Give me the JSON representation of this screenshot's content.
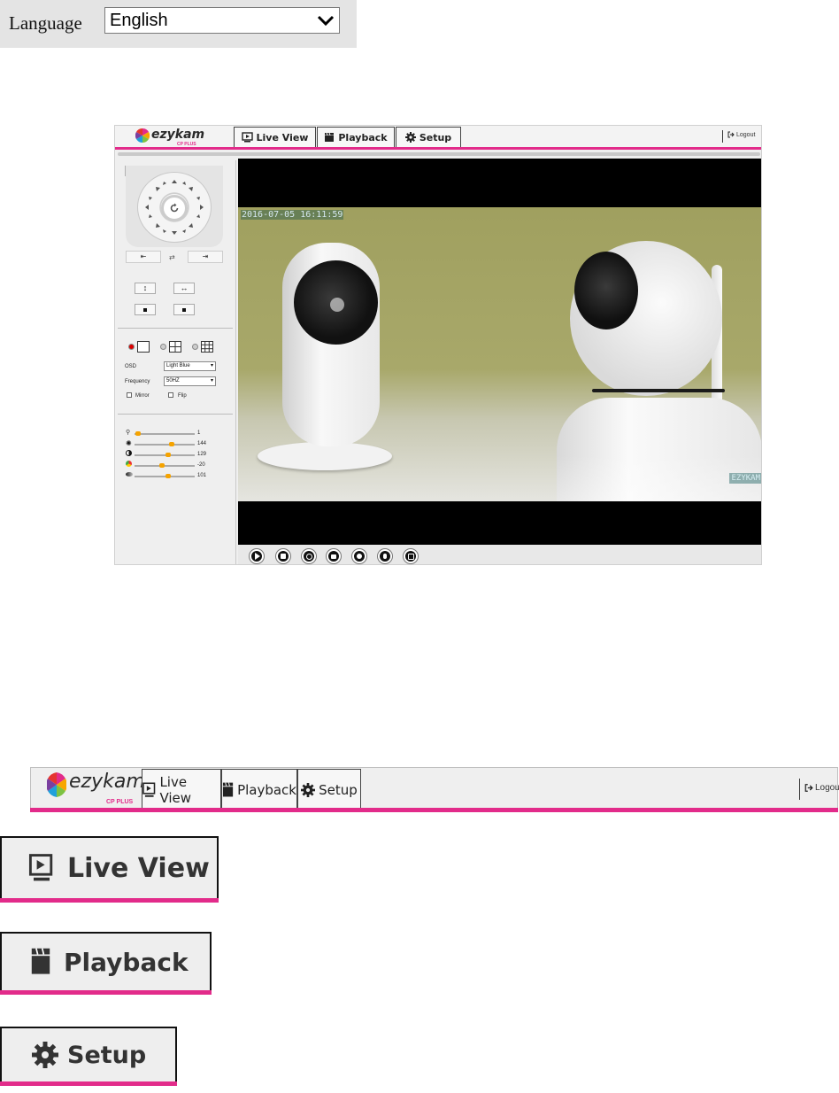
{
  "language": {
    "label": "Language",
    "selected": "English"
  },
  "header": {
    "logo": "ezykam",
    "logo_sub": "CP PLUS",
    "tabs": [
      {
        "label": "Live View",
        "icon": "live-view-icon"
      },
      {
        "label": "Playback",
        "icon": "clapperboard-icon"
      },
      {
        "label": "Setup",
        "icon": "gear-icon"
      }
    ],
    "logout": "Logout"
  },
  "video": {
    "timestamp": "2016-07-05 16:11:59",
    "watermark": "EZYKAM"
  },
  "sidebar": {
    "osd_label": "OSD",
    "osd_value": "Light Blue",
    "frequency_label": "Frequency",
    "frequency_value": "50HZ",
    "mirror_label": "Mirror",
    "flip_label": "Flip",
    "sliders": [
      {
        "icon": "speed-icon",
        "value": "1"
      },
      {
        "icon": "brightness-icon",
        "value": "144"
      },
      {
        "icon": "contrast-icon",
        "value": "129"
      },
      {
        "icon": "hue-icon",
        "value": "-20"
      },
      {
        "icon": "saturation-icon",
        "value": "101"
      }
    ]
  },
  "bottom_controls": [
    "play-icon",
    "stop-icon",
    "snapshot-icon",
    "record-icon",
    "audio-icon",
    "talk-icon",
    "fullscreen-icon"
  ],
  "colors": {
    "accent": "#e22b8a",
    "knob": "#f5a300"
  }
}
